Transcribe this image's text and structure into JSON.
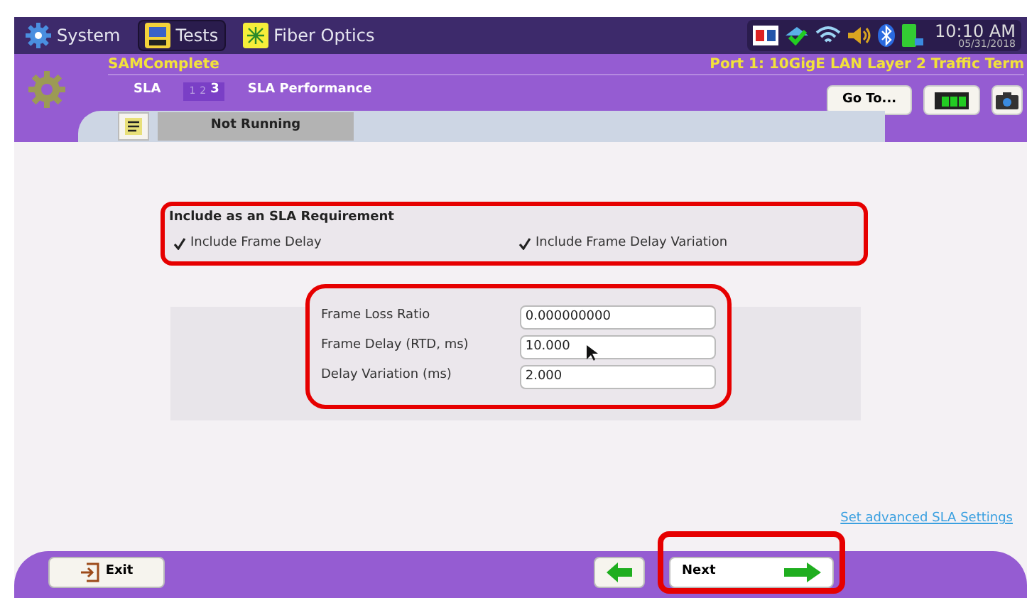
{
  "top_bar": {
    "tabs": [
      {
        "label": "System",
        "selected": false
      },
      {
        "label": "Tests",
        "selected": true
      },
      {
        "label": "Fiber Optics",
        "selected": false
      }
    ],
    "time": "10:10 AM",
    "date": "05/31/2018"
  },
  "header": {
    "test_name": "SAMComplete",
    "port": "Port 1: 10GigE LAN Layer 2 Traffic Term",
    "section": "SLA",
    "steps": [
      {
        "label": "1",
        "selected": false
      },
      {
        "label": "2",
        "selected": false
      },
      {
        "label": "3",
        "selected": true
      }
    ],
    "page_title": "SLA Performance",
    "goto_button": "Go To..."
  },
  "status": {
    "text": "Not Running"
  },
  "requirements": {
    "title": "Include as an SLA Requirement",
    "options": [
      {
        "label": "Include Frame Delay",
        "checked": true
      },
      {
        "label": "Include Frame Delay Variation",
        "checked": true
      }
    ]
  },
  "thresholds": [
    {
      "label": "Frame Loss Ratio",
      "value": "0.000000000"
    },
    {
      "label": "Frame Delay (RTD, ms)",
      "value": "10.000"
    },
    {
      "label": "Delay Variation (ms)",
      "value": "2.000"
    }
  ],
  "advanced_link": "Set advanced SLA Settings",
  "footer": {
    "exit": "Exit",
    "next": "Next"
  }
}
